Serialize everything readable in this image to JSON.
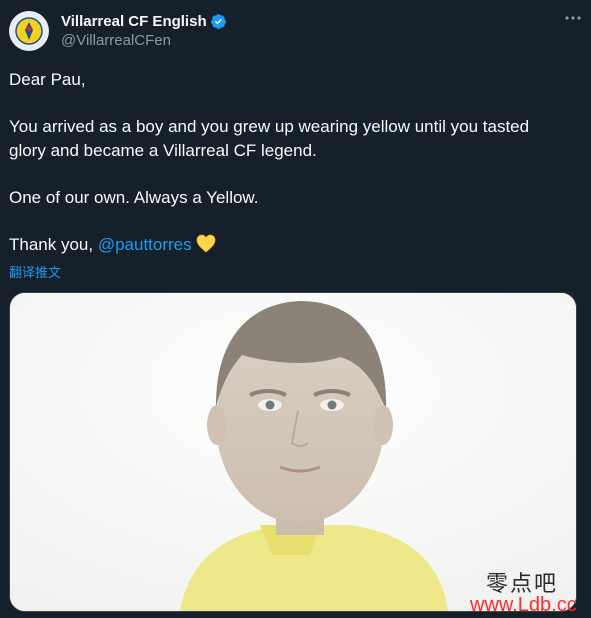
{
  "account": {
    "display_name": "Villarreal CF English",
    "handle": "@VillarrealCFen"
  },
  "tweet": {
    "line1": "Dear Pau,",
    "line2": "You arrived as a boy and you grew up wearing yellow until you tasted glory and became a Villarreal CF legend.",
    "line3": "One of our own. Always a Yellow.",
    "line4_prefix": "Thank you, ",
    "mention": "@pauttorres",
    "emoji": "yellow-heart-icon"
  },
  "translate_label": "翻译推文",
  "media": {
    "description_icon": "photo"
  },
  "watermark": {
    "cn": "零点吧",
    "url": "www.Ldb.cc"
  },
  "colors": {
    "background": "#15202b",
    "link": "#1d9bf0",
    "verified": "#1d9bf0",
    "heart": "#ffd54a"
  }
}
